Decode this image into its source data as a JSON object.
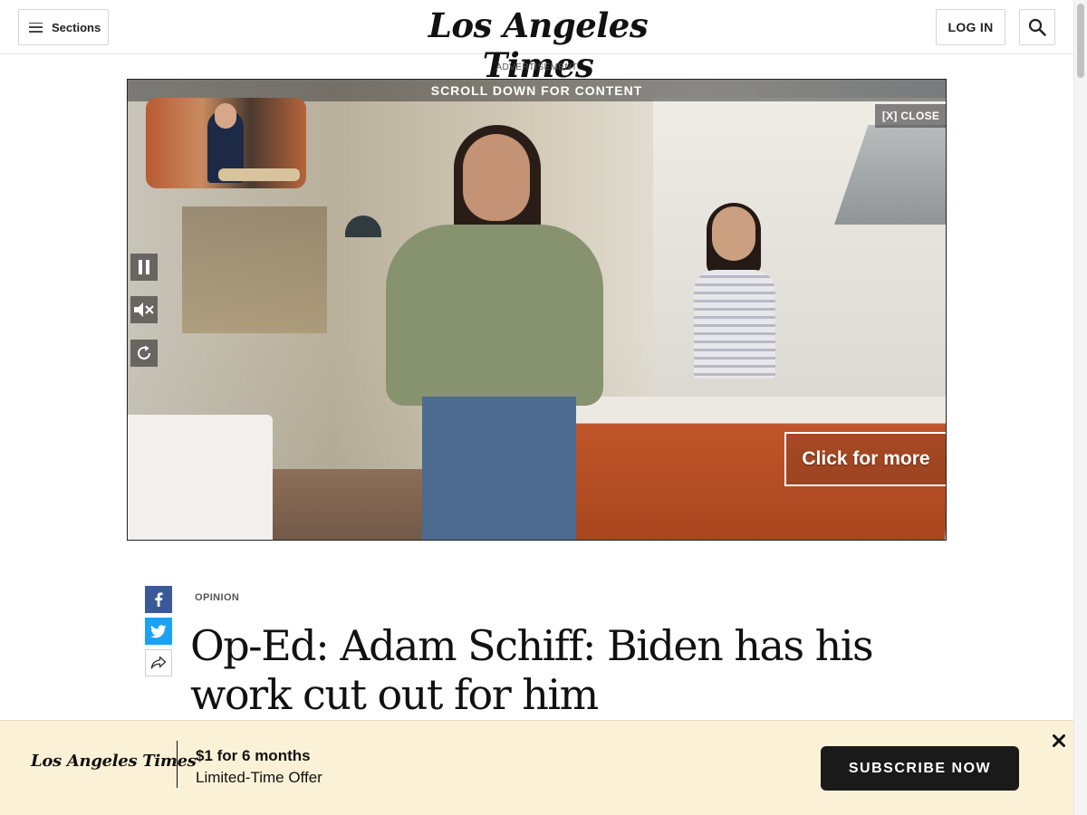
{
  "header": {
    "sections_label": "Sections",
    "logo_text": "Los Angeles Times",
    "login_label": "LOG IN"
  },
  "ad": {
    "label": "ADVERTISEMENT",
    "scroll_notice": "SCROLL DOWN FOR CONTENT",
    "close_label": "[X] CLOSE",
    "cta_label": "Click for more"
  },
  "article": {
    "section": "OPINION",
    "headline": "Op-Ed: Adam Schiff: Biden has his work cut out for him"
  },
  "subscribe": {
    "logo_text": "Los Angeles Times",
    "price": "$1 for 6 months",
    "offer": "Limited-Time Offer",
    "button_label": "SUBSCRIBE NOW"
  },
  "icons": {
    "menu": "hamburger-icon",
    "search": "search-icon",
    "pause": "pause-icon",
    "mute": "mute-icon",
    "replay": "replay-icon",
    "facebook": "facebook-icon",
    "twitter": "twitter-icon",
    "share": "share-icon",
    "close": "close-icon"
  },
  "colors": {
    "facebook": "#3b5998",
    "twitter": "#1da1f2",
    "subscribe_bar": "#fbf1d6",
    "subscribe_button": "#1a1a1a"
  }
}
